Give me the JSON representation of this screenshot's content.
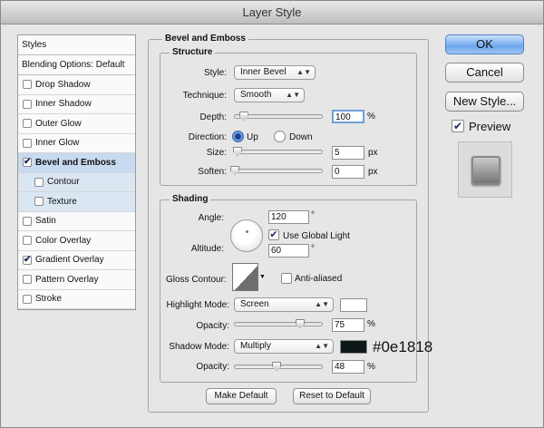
{
  "window": {
    "title": "Layer Style"
  },
  "styles_panel": {
    "header": "Styles",
    "blending_options": "Blending Options: Default",
    "items": [
      {
        "label": "Drop Shadow",
        "checked": false
      },
      {
        "label": "Inner Shadow",
        "checked": false
      },
      {
        "label": "Outer Glow",
        "checked": false
      },
      {
        "label": "Inner Glow",
        "checked": false
      },
      {
        "label": "Bevel and Emboss",
        "checked": true,
        "selected": true
      },
      {
        "label": "Contour",
        "checked": false,
        "sub": true
      },
      {
        "label": "Texture",
        "checked": false,
        "sub": true
      },
      {
        "label": "Satin",
        "checked": false
      },
      {
        "label": "Color Overlay",
        "checked": false
      },
      {
        "label": "Gradient Overlay",
        "checked": true
      },
      {
        "label": "Pattern Overlay",
        "checked": false
      },
      {
        "label": "Stroke",
        "checked": false
      }
    ]
  },
  "bevel": {
    "title": "Bevel and Emboss",
    "structure": {
      "legend": "Structure",
      "style_label": "Style:",
      "style_value": "Inner Bevel",
      "technique_label": "Technique:",
      "technique_value": "Smooth",
      "depth_label": "Depth:",
      "depth_value": "100",
      "depth_unit": "%",
      "depth_fraction": 0.1,
      "direction_label": "Direction:",
      "direction_up": "Up",
      "direction_down": "Down",
      "size_label": "Size:",
      "size_value": "5",
      "size_unit": "px",
      "size_fraction": 0.03,
      "soften_label": "Soften:",
      "soften_value": "0",
      "soften_unit": "px",
      "soften_fraction": 0.0
    },
    "shading": {
      "legend": "Shading",
      "angle_label": "Angle:",
      "angle_value": "120",
      "angle_unit": "°",
      "global_light_label": "Use Global Light",
      "altitude_label": "Altitude:",
      "altitude_value": "60",
      "altitude_unit": "°",
      "gloss_label": "Gloss Contour:",
      "anti_aliased_label": "Anti-aliased",
      "highlight_mode_label": "Highlight Mode:",
      "highlight_mode_value": "Screen",
      "highlight_color": "#ffffff",
      "highlight_opacity_label": "Opacity:",
      "highlight_opacity_value": "75",
      "highlight_opacity_unit": "%",
      "highlight_opacity_fraction": 0.75,
      "shadow_mode_label": "Shadow Mode:",
      "shadow_mode_value": "Multiply",
      "shadow_color": "#0e1818",
      "shadow_color_annotation": "#0e1818",
      "shadow_opacity_label": "Opacity:",
      "shadow_opacity_value": "48",
      "shadow_opacity_unit": "%",
      "shadow_opacity_fraction": 0.48
    },
    "make_default": "Make Default",
    "reset_default": "Reset to Default"
  },
  "buttons": {
    "ok": "OK",
    "cancel": "Cancel",
    "new_style": "New Style...",
    "preview_label": "Preview"
  }
}
